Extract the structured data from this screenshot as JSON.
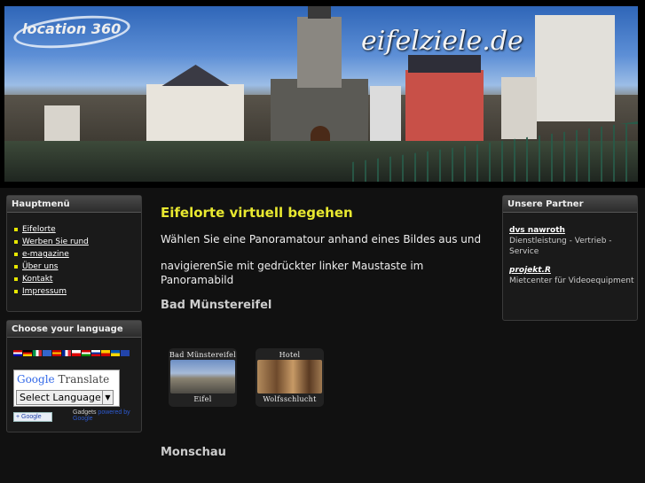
{
  "header": {
    "logo_text": "location 360",
    "site_title": "eifelziele.de"
  },
  "main_menu": {
    "title": "Hauptmenü",
    "items": [
      {
        "label": "Eifelorte"
      },
      {
        "label": "Werben Sie rund"
      },
      {
        "label": "e-magazine"
      },
      {
        "label": "Über uns"
      },
      {
        "label": "Kontakt"
      },
      {
        "label": "Impressum"
      }
    ]
  },
  "language": {
    "title": "Choose your language",
    "translate_brand": "Google",
    "translate_word": "Translate",
    "select_value": "Select Language",
    "add_button": "+ Google",
    "gadgets_text": "Gadgets",
    "gadgets_link": "powered by Google"
  },
  "partners": {
    "title": "Unsere Partner",
    "items": [
      {
        "name": "dvs nawroth",
        "desc": "Dienstleistung - Vertrieb - Service"
      },
      {
        "name": "projekt.R",
        "desc": "Mietcenter für Videoequipment"
      }
    ]
  },
  "main": {
    "heading": "Eifelorte virtuell begehen",
    "intro1": "Wählen Sie eine Panoramatour anhand eines Bildes aus und",
    "intro2": "navigierenSie mit gedrückter linker Maustaste im Panoramabild",
    "section1": "Bad Münstereifel",
    "thumbs": [
      {
        "top": "Bad Münstereifel",
        "bottom": "Eifel"
      },
      {
        "top": "Hotel",
        "bottom": "Wolfsschlucht"
      }
    ],
    "section2": "Monschau"
  },
  "colors": {
    "accent": "#e8e830",
    "background": "#111111"
  }
}
